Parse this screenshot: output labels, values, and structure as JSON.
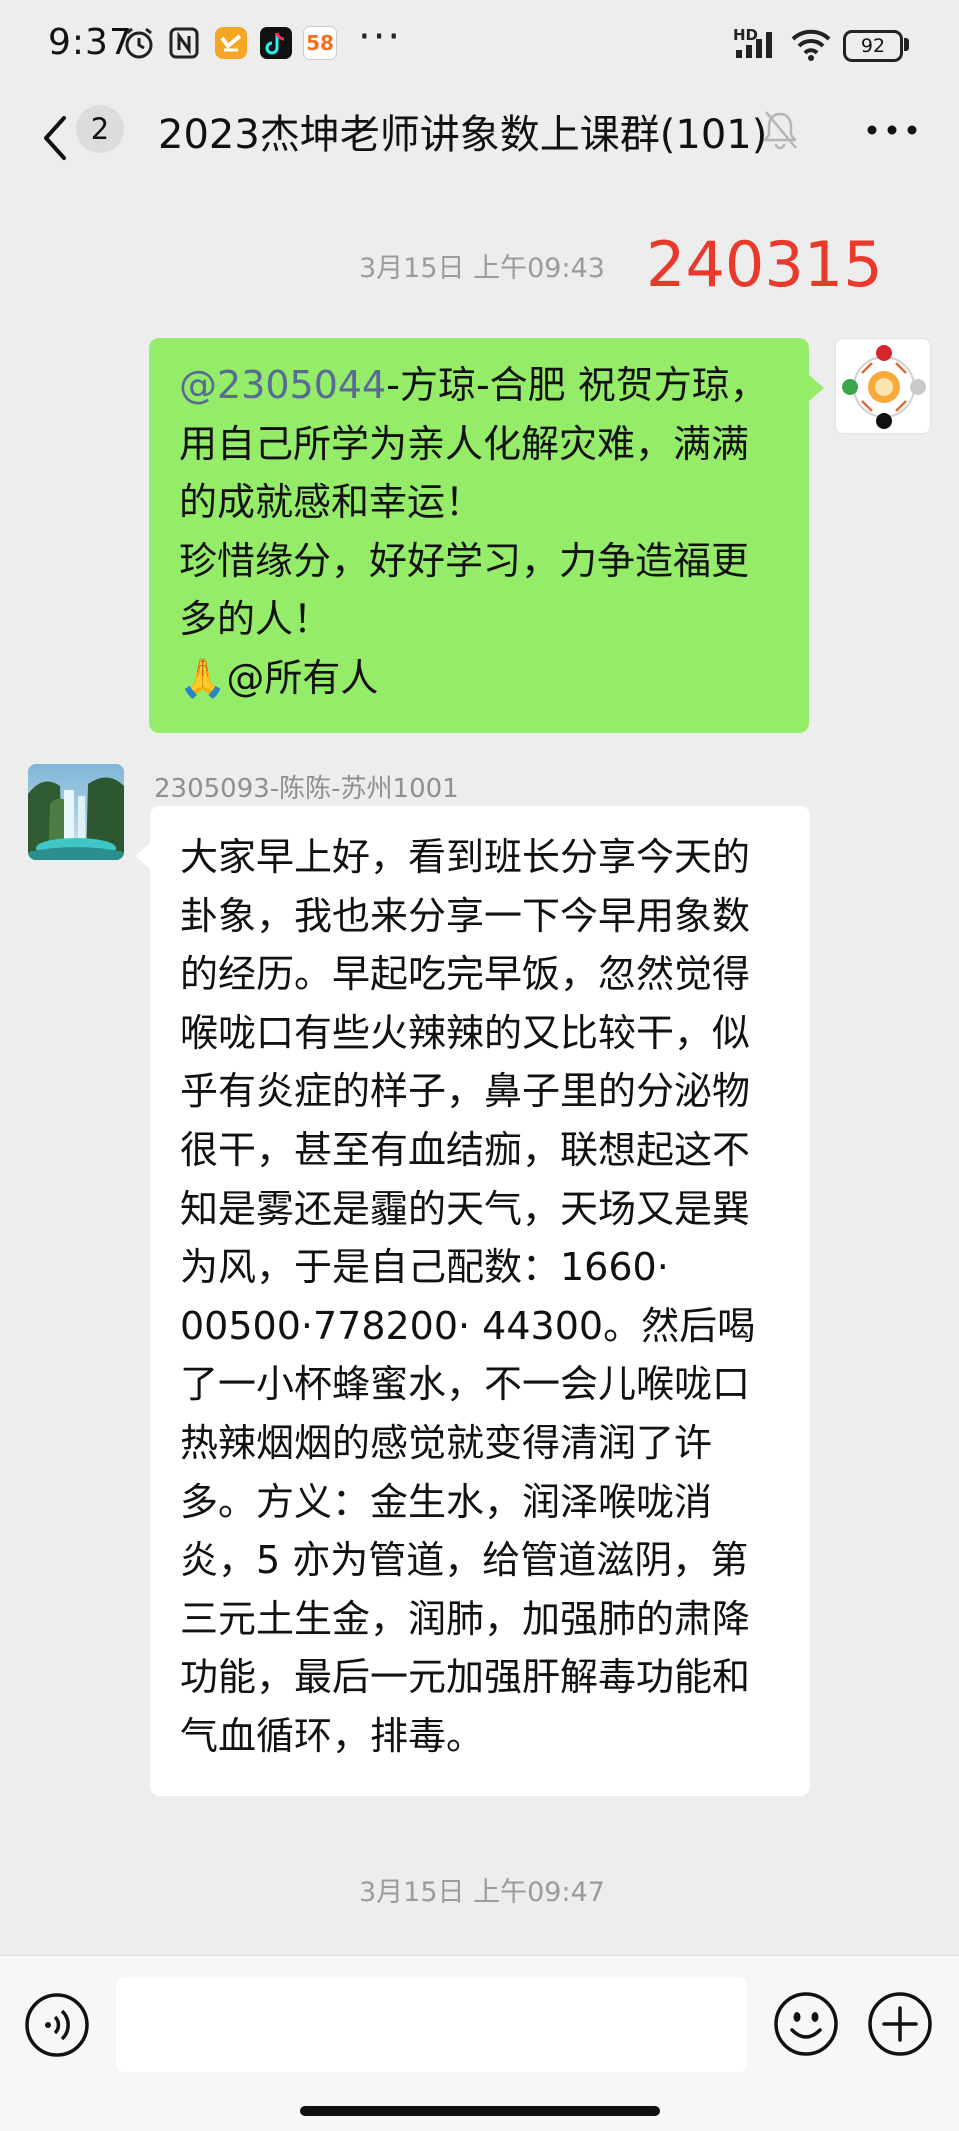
{
  "status_bar": {
    "time": "9:37",
    "network": "HD",
    "battery": "92",
    "dots": "···",
    "app_badge_58": "58",
    "icons": [
      "alarm-icon",
      "nfc-icon",
      "app-icon",
      "tiktok-icon",
      "58-app-icon",
      "signal-icon",
      "wifi-icon",
      "battery-icon"
    ]
  },
  "header": {
    "unread_count": "2",
    "title": "2023杰坤老师讲象数上课群(101)",
    "icons": [
      "back-arrow-icon",
      "mute-bell-icon",
      "more-icon"
    ]
  },
  "annotation": "240315",
  "messages": [
    {
      "timestamp": "3月15日 上午09:43",
      "from_self": true,
      "lines": [
        {
          "mention": "@2305044",
          "text": "-方琼-合肥  祝贺方琼，"
        },
        {
          "text": "用自己所学为亲人化解灾难，满满"
        },
        {
          "text": "的成就感和幸运！"
        },
        {
          "text": "珍惜缘分，好好学习，力争造福更"
        },
        {
          "text": "多的人！"
        },
        {
          "emoji": "🙏",
          "text": "@所有人"
        }
      ]
    },
    {
      "sender": "2305093-陈陈-苏州1001",
      "from_self": false,
      "lines": [
        "大家早上好，看到班长分享今天的",
        "卦象，我也来分享一下今早用象数",
        "的经历。早起吃完早饭，忽然觉得",
        "喉咙口有些火辣辣的又比较干，似",
        "乎有炎症的样子，鼻子里的分泌物",
        "很干，甚至有血结痂，联想起这不",
        "知是雾还是霾的天气，天场又是巽",
        "为风，于是自己配数：1660·",
        "00500·778200· 44300。然后喝",
        "了一小杯蜂蜜水，不一会儿喉咙口",
        "热辣烟烟的感觉就变得清润了许",
        "多。方义：金生水，润泽喉咙消",
        "炎，5 亦为管道，给管道滋阴，第",
        "三元土生金，润肺，加强肺的肃降",
        "功能，最后一元加强肝解毒功能和",
        "气血循环，排毒。"
      ]
    }
  ],
  "last_timestamp": "3月15日 上午09:47",
  "input": {
    "value": "",
    "icons": [
      "voice-icon",
      "emoji-icon",
      "plus-icon"
    ]
  },
  "colors": {
    "background": "#ededed",
    "bubble_self": "#95ec69",
    "bubble_other": "#ffffff",
    "mention": "#576b95",
    "annotation_red": "#e8392b",
    "timestamp": "#9b9b9b"
  }
}
